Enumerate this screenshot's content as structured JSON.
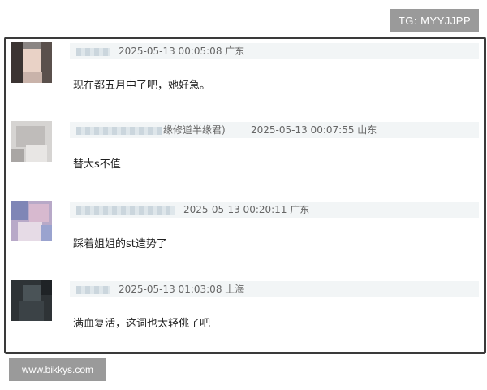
{
  "watermark_top": "TG: MYYJJPP",
  "watermark_bottom": "www.bikkys.com",
  "comments": [
    {
      "nick_suffix": "",
      "meta": "2025-05-13 00:05:08 广东",
      "content": "现在都五月中了吧，她好急。"
    },
    {
      "nick_suffix": "缘修道半缘君)",
      "meta": "2025-05-13 00:07:55 山东",
      "content": "替大s不值"
    },
    {
      "nick_suffix": "",
      "meta": "2025-05-13 00:20:11 广东",
      "content": "踩着姐姐的st造势了"
    },
    {
      "nick_suffix": "",
      "meta": "2025-05-13 01:03:08 上海",
      "content": "满血复活，这词也太轻佻了吧"
    }
  ],
  "colors": {
    "badge_bg": "#9a9a9a",
    "meta_bar_bg": "#f2f5f6",
    "frame_border": "#3a3a3a"
  }
}
